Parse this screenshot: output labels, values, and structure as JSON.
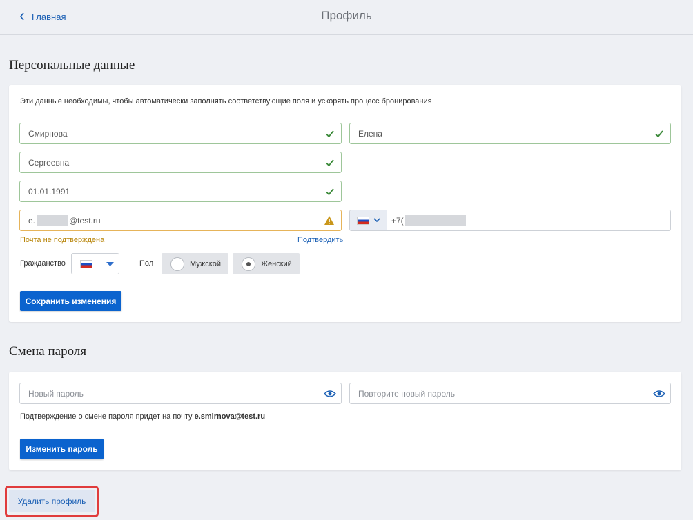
{
  "header": {
    "back_label": "Главная",
    "title": "Профиль"
  },
  "personal": {
    "section_title": "Персональные данные",
    "note": "Эти данные необходимы, чтобы автоматически заполнять соответствующие поля и ускорять процесс бронирования",
    "last_name": "Смирнова",
    "first_name": "Елена",
    "middle_name": "Сергеевна",
    "birth_date": "01.01.1991",
    "email_prefix": "e.",
    "email_suffix": "@test.ru",
    "phone_prefix": "+7(",
    "email_status": "Почта не подтверждена",
    "confirm_link": "Подтвердить",
    "citizenship_label": "Гражданство",
    "gender_label": "Пол",
    "gender_male": "Мужской",
    "gender_female": "Женский",
    "gender_selected": "Женский",
    "save_button": "Сохранить изменения"
  },
  "password": {
    "section_title": "Смена пароля",
    "new_placeholder": "Новый пароль",
    "repeat_placeholder": "Повторите новый пароль",
    "confirm_note": "Подтверждение о смене пароля придет на почту",
    "confirm_email": "e.smirnova@test.ru",
    "change_button": "Изменить пароль"
  },
  "delete_button": "Удалить профиль",
  "colors": {
    "accent": "#0b63ce",
    "link": "#1a5fb4",
    "valid_border": "#9ec69a",
    "warning": "#e6b45a",
    "highlight": "#e03c3c"
  }
}
